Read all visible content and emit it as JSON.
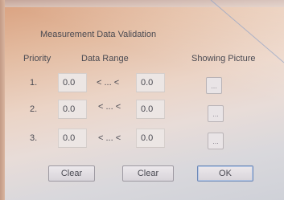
{
  "dialog": {
    "title": "Measurement Data Validation"
  },
  "headers": {
    "priority": "Priority",
    "data_range": "Data Range",
    "showing_picture": "Showing Picture"
  },
  "rows": [
    {
      "priority": "1.",
      "min": "0.0",
      "between": "< ... <",
      "max": "0.0",
      "picture_button": "..."
    },
    {
      "priority": "2.",
      "min": "0.0",
      "between": "< ... <",
      "max": "0.0",
      "picture_button": "..."
    },
    {
      "priority": "3.",
      "min": "0.0",
      "between": "< ... <",
      "max": "0.0",
      "picture_button": "..."
    }
  ],
  "buttons": {
    "clear_1": "Clear",
    "clear_2": "Clear",
    "ok": "OK"
  }
}
